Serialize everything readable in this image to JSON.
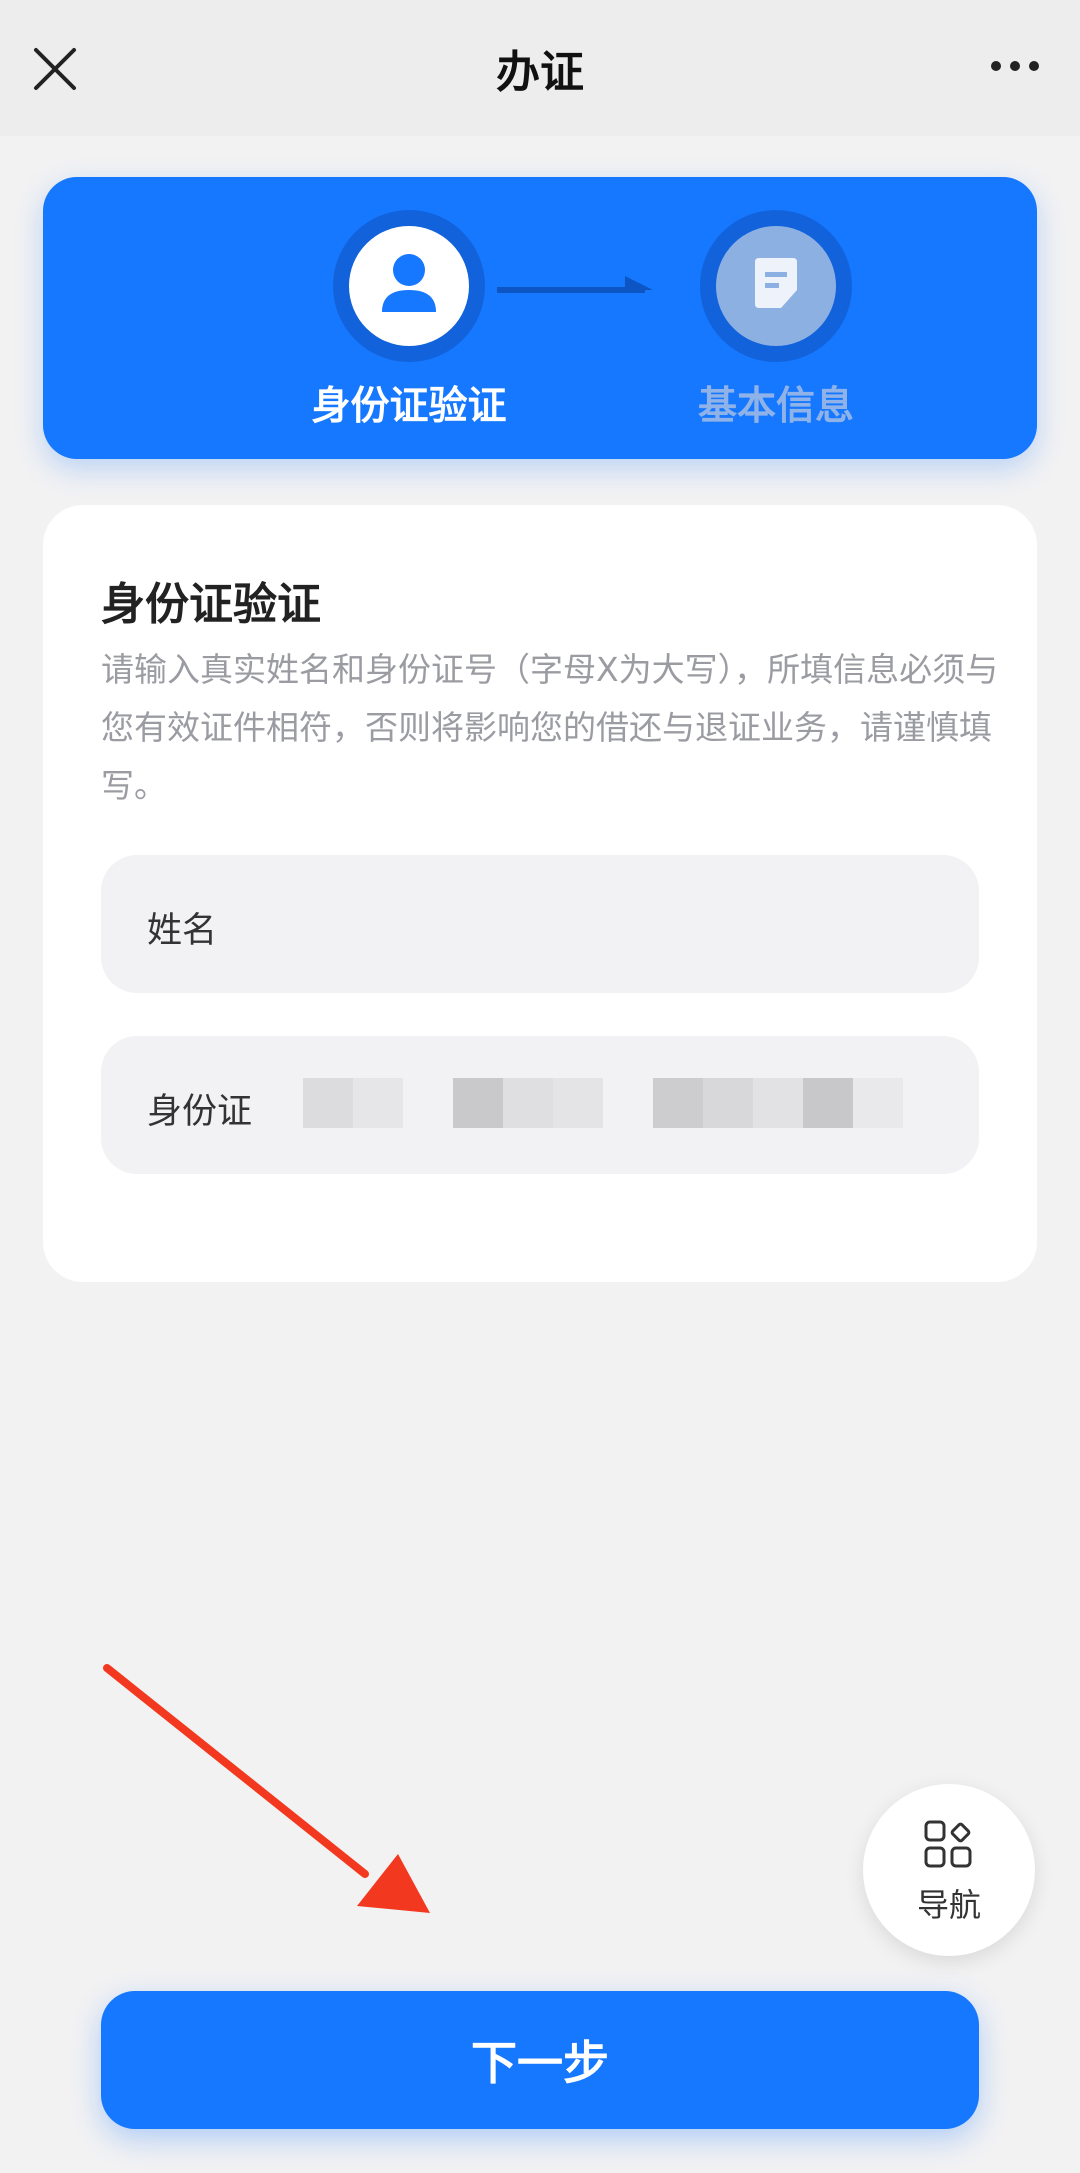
{
  "header": {
    "title": "办证",
    "close_icon": "close-icon",
    "more_icon": "more-icon"
  },
  "steps": [
    {
      "label": "身份证验证",
      "icon": "user-icon",
      "state": "active"
    },
    {
      "label": "基本信息",
      "icon": "document-icon",
      "state": "inactive"
    }
  ],
  "form": {
    "title": "身份证验证",
    "description": "请输入真实姓名和身份证号（字母X为大写），所填信息必须与您有效证件相符，否则将影响您的借还与退证业务，请谨慎填写。",
    "fields": [
      {
        "label": "姓名",
        "value": ""
      },
      {
        "label": "身份证",
        "value": ""
      }
    ]
  },
  "floating_nav": {
    "label": "导航",
    "icon": "grid-icon"
  },
  "primary_button": {
    "label": "下一步"
  },
  "colors": {
    "accent": "#1677ff",
    "background": "#f2f2f3",
    "annotation_arrow": "#f2391f"
  }
}
